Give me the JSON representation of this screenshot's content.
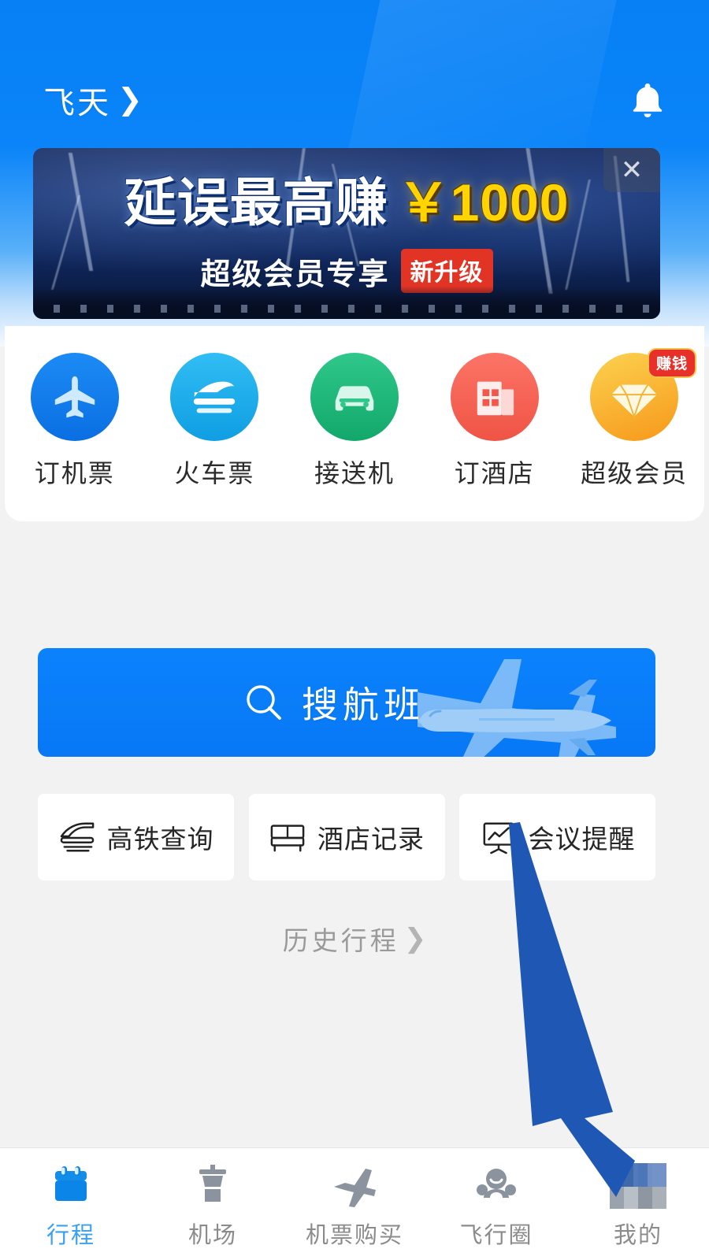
{
  "header": {
    "brand": "飞天",
    "chevron": "❯",
    "bell_icon": "bell-icon"
  },
  "banner": {
    "headline_main": "延误最高赚",
    "headline_amount": "￥1000",
    "subtitle": "超级会员专享",
    "badge": "新升级",
    "close_label": "✕"
  },
  "quick_entries": [
    {
      "label": "订机票",
      "icon": "airplane-icon",
      "color": "#1480f0",
      "color2": "#0b6fe0",
      "badge": ""
    },
    {
      "label": "火车票",
      "icon": "train-icon",
      "color": "#23b4f0",
      "color2": "#139ae0",
      "badge": ""
    },
    {
      "label": "接送机",
      "icon": "car-icon",
      "color": "#26be7f",
      "color2": "#14a86c",
      "badge": ""
    },
    {
      "label": "订酒店",
      "icon": "hotel-icon",
      "color": "#fa6a5c",
      "color2": "#ef5445",
      "badge": ""
    },
    {
      "label": "超级会员",
      "icon": "diamond-icon",
      "color": "#fbc63f",
      "color2": "#f79a1a",
      "badge": "赚钱"
    }
  ],
  "search": {
    "label": "搜航班",
    "icon": "search-icon",
    "art": "airplane-illustration",
    "color": "#077EFC"
  },
  "tiles": [
    {
      "label": "高铁查询",
      "icon": "high-speed-rail-icon"
    },
    {
      "label": "酒店记录",
      "icon": "bed-icon"
    },
    {
      "label": "会议提醒",
      "icon": "presentation-board-icon"
    }
  ],
  "history": {
    "label": "历史行程",
    "chevron": "❯"
  },
  "annotation": {
    "type": "arrow",
    "color": "#1F57B5",
    "from": "会议提醒",
    "to": "我的"
  },
  "tabbar": [
    {
      "label": "行程",
      "icon": "calendar-icon",
      "active": true
    },
    {
      "label": "机场",
      "icon": "control-tower-icon",
      "active": false
    },
    {
      "label": "机票购买",
      "icon": "plane-tilt-icon",
      "active": false
    },
    {
      "label": "飞行圈",
      "icon": "group-people-icon",
      "active": false
    },
    {
      "label": "我的",
      "icon": "mosaic-redacted-icon",
      "active": false
    }
  ],
  "colors": {
    "brand_blue": "#0780F6",
    "page_bg": "#F2F2F2",
    "accent_red": "#E23425",
    "accent_yellow": "#FFD400",
    "active_tab": "#3AA0EF"
  }
}
